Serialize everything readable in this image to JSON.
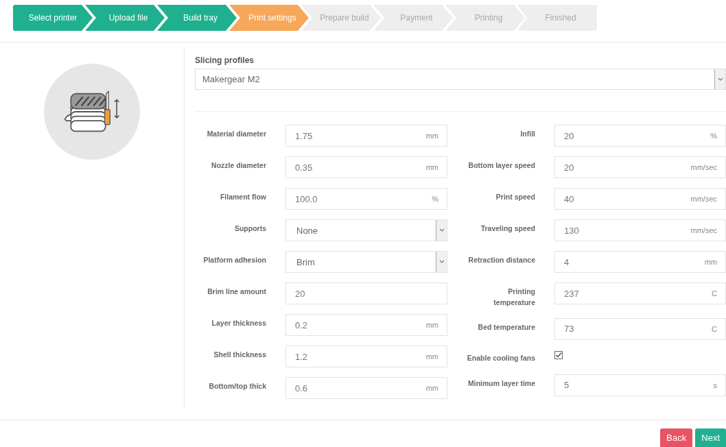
{
  "steps": [
    {
      "label": "Select printer",
      "completed": true,
      "selected": false
    },
    {
      "label": "Upload file",
      "completed": true,
      "selected": false
    },
    {
      "label": "Build tray",
      "completed": true,
      "selected": false
    },
    {
      "label": "Print settings",
      "completed": false,
      "selected": true
    },
    {
      "label": "Prepare build",
      "completed": false,
      "selected": false
    },
    {
      "label": "Payment",
      "completed": false,
      "selected": false
    },
    {
      "label": "Printing",
      "completed": false,
      "selected": false
    },
    {
      "label": "Finished",
      "completed": false,
      "selected": false
    }
  ],
  "slicing_profiles": {
    "label": "Slicing profiles",
    "value": "Makergear M2"
  },
  "left_fields": [
    {
      "kind": "text",
      "label": "Material diameter",
      "value": "1.75",
      "unit": "mm"
    },
    {
      "kind": "text",
      "label": "Nozzle diameter",
      "value": "0.35",
      "unit": "mm"
    },
    {
      "kind": "text",
      "label": "Filament flow",
      "value": "100.0",
      "unit": "%"
    },
    {
      "kind": "select",
      "label": "Supports",
      "value": "None"
    },
    {
      "kind": "select",
      "label": "Platform adhesion",
      "value": "Brim"
    },
    {
      "kind": "text",
      "label": "Brim line amount",
      "value": "20"
    },
    {
      "kind": "text",
      "label": "Layer thickness",
      "value": "0.2",
      "unit": "mm"
    },
    {
      "kind": "text",
      "label": "Shell thickness",
      "value": "1.2",
      "unit": "mm"
    },
    {
      "kind": "text",
      "label": "Bottom/top thick",
      "value": "0.6",
      "unit": "mm"
    }
  ],
  "right_fields": [
    {
      "kind": "text",
      "label": "Infill",
      "value": "20",
      "unit": "%"
    },
    {
      "kind": "text",
      "label": "Bottom layer speed",
      "value": "20",
      "unit": "mm/sec"
    },
    {
      "kind": "text",
      "label": "Print speed",
      "value": "40",
      "unit": "mm/sec"
    },
    {
      "kind": "text",
      "label": "Traveling speed",
      "value": "130",
      "unit": "mm/sec"
    },
    {
      "kind": "text",
      "label": "Retraction distance",
      "value": "4",
      "unit": "mm"
    },
    {
      "kind": "text",
      "label": "Printing temperature",
      "value": "237",
      "unit": "C"
    },
    {
      "kind": "text",
      "label": "Bed temperature",
      "value": "73",
      "unit": "C"
    },
    {
      "kind": "checkbox",
      "label": "Enable cooling fans",
      "checked": true
    },
    {
      "kind": "text",
      "label": "Minimum layer time",
      "value": "5",
      "unit": "s"
    }
  ],
  "buttons": [
    {
      "label": "Back",
      "kind": "back"
    },
    {
      "label": "Next",
      "kind": "next"
    }
  ]
}
